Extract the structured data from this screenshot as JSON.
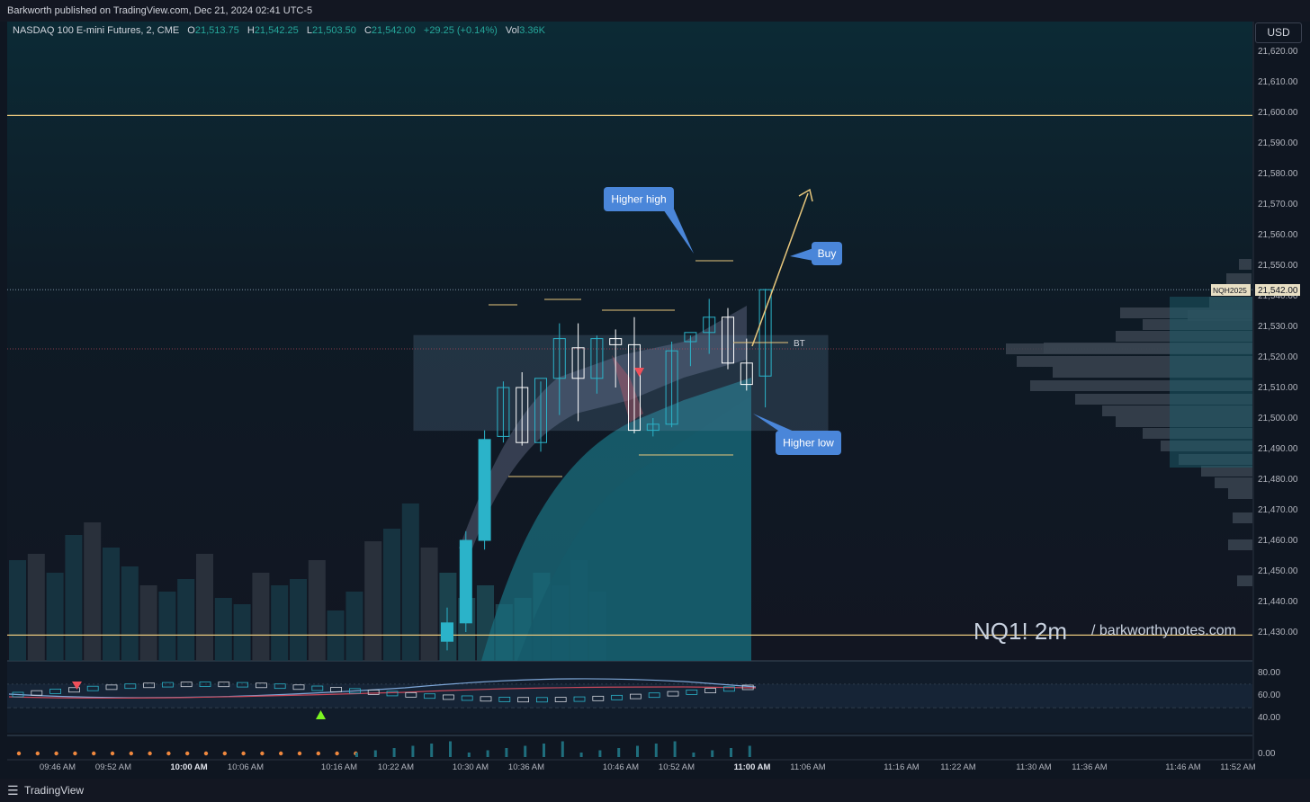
{
  "header": {
    "publisher_text": "Barkworth published on TradingView.com, Dec 21, 2024 02:41 UTC-5"
  },
  "legend": {
    "symbol": "NASDAQ 100 E-mini Futures, 2, CME",
    "open_label": "O",
    "open": "21,513.75",
    "high_label": "H",
    "high": "21,542.25",
    "low_label": "L",
    "low": "21,503.50",
    "close_label": "C",
    "close": "21,542.00",
    "change": "+29.25 (+0.14%)",
    "vol_label": "Vol",
    "vol": "3.36K"
  },
  "currency": "USD",
  "price_tag": {
    "symbol": "NQH2025",
    "value": "21,542.00"
  },
  "watermark": {
    "main": "NQ1! 2m",
    "site": "/ barkworthynotes.com"
  },
  "footer": {
    "brand": "TradingView"
  },
  "colors": {
    "up": "#2bb3c9",
    "down": "#ffffff",
    "accent_line": "#e8c77c",
    "callout": "#4a86d9",
    "sell_marker": "#f0505a",
    "buy_marker": "#7cf521"
  },
  "chart_data": {
    "type": "candlestick",
    "price_axis": {
      "ticks": [
        "21,620.00",
        "21,610.00",
        "21,600.00",
        "21,590.00",
        "21,580.00",
        "21,570.00",
        "21,560.00",
        "21,550.00",
        "21,540.00",
        "21,530.00",
        "21,520.00",
        "21,510.00",
        "21,500.00",
        "21,490.00",
        "21,480.00",
        "21,470.00",
        "21,460.00",
        "21,450.00",
        "21,440.00",
        "21,430.00"
      ],
      "ylim": [
        21425,
        21622
      ]
    },
    "oscillator_axis": {
      "ticks": [
        "80.00",
        "60.00",
        "40.00"
      ]
    },
    "volume_axis": {
      "ticks": [
        "0.00"
      ]
    },
    "time_axis": {
      "ticks": [
        {
          "label": "09:46 AM",
          "bold": false
        },
        {
          "label": "09:52 AM",
          "bold": false
        },
        {
          "label": "10:00 AM",
          "bold": true
        },
        {
          "label": "10:06 AM",
          "bold": false
        },
        {
          "label": "10:16 AM",
          "bold": false
        },
        {
          "label": "10:22 AM",
          "bold": false
        },
        {
          "label": "10:30 AM",
          "bold": false
        },
        {
          "label": "10:36 AM",
          "bold": false
        },
        {
          "label": "10:46 AM",
          "bold": false
        },
        {
          "label": "10:52 AM",
          "bold": false
        },
        {
          "label": "11:00 AM",
          "bold": true
        },
        {
          "label": "11:06 AM",
          "bold": false
        },
        {
          "label": "11:16 AM",
          "bold": false
        },
        {
          "label": "11:22 AM",
          "bold": false
        },
        {
          "label": "11:30 AM",
          "bold": false
        },
        {
          "label": "11:36 AM",
          "bold": false
        },
        {
          "label": "11:46 AM",
          "bold": false
        },
        {
          "label": "11:52 AM",
          "bold": false
        }
      ]
    },
    "candles": [
      {
        "o": 21427,
        "h": 21438,
        "l": 21424,
        "c": 21433
      },
      {
        "o": 21433,
        "h": 21463,
        "l": 21430,
        "c": 21460
      },
      {
        "o": 21460,
        "h": 21496,
        "l": 21457,
        "c": 21493
      },
      {
        "o": 21494,
        "h": 21512,
        "l": 21492,
        "c": 21510
      },
      {
        "o": 21510,
        "h": 21515,
        "l": 21491,
        "c": 21492
      },
      {
        "o": 21492,
        "h": 21512,
        "l": 21489,
        "c": 21513
      },
      {
        "o": 21513,
        "h": 21531,
        "l": 21501,
        "c": 21526
      },
      {
        "o": 21523,
        "h": 21531,
        "l": 21499,
        "c": 21513
      },
      {
        "o": 21513,
        "h": 21527,
        "l": 21508,
        "c": 21526
      },
      {
        "o": 21526,
        "h": 21529,
        "l": 21510,
        "c": 21524
      },
      {
        "o": 21524,
        "h": 21533,
        "l": 21495,
        "c": 21496
      },
      {
        "o": 21496,
        "h": 21500,
        "l": 21494,
        "c": 21498
      },
      {
        "o": 21498,
        "h": 21525,
        "l": 21497,
        "c": 21522
      },
      {
        "o": 21525,
        "h": 21527,
        "l": 21517,
        "c": 21528
      },
      {
        "o": 21528,
        "h": 21539,
        "l": 21521,
        "c": 21533
      },
      {
        "o": 21533,
        "h": 21536,
        "l": 21516,
        "c": 21518
      },
      {
        "o": 21518,
        "h": 21526,
        "l": 21509,
        "c": 21511
      },
      {
        "o": 21513.75,
        "h": 21542.25,
        "l": 21503.5,
        "c": 21542
      }
    ],
    "volume_bars": [
      46,
      47,
      44,
      50,
      52,
      48,
      45,
      42,
      41,
      43,
      47,
      40,
      39,
      44,
      42,
      43,
      46,
      38,
      41,
      49,
      51,
      55,
      48,
      44,
      40,
      42,
      39,
      40,
      44,
      42,
      46,
      41
    ],
    "horizontal_levels": [
      21599,
      21429
    ],
    "zone": {
      "top": 21527,
      "bottom": 21496
    },
    "last_price_line": 21542,
    "annotations": [
      {
        "text": "Higher high"
      },
      {
        "text": "Buy"
      },
      {
        "text": "Higher low"
      },
      {
        "text": "BT"
      }
    ]
  }
}
